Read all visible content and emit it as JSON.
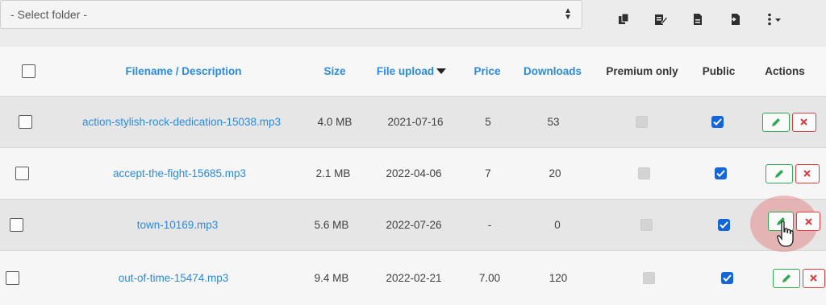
{
  "folder_select": {
    "value": "- Select folder -"
  },
  "toolbar": {
    "icons": [
      "copy-icon",
      "edit-document-icon",
      "file-icon",
      "file-move-icon",
      "more-options-icon"
    ]
  },
  "table": {
    "headers": {
      "filename": "Filename / Description",
      "size": "Size",
      "upload": "File upload",
      "price": "Price",
      "downloads": "Downloads",
      "premium": "Premium only",
      "public": "Public",
      "actions": "Actions"
    },
    "rows": [
      {
        "filename": "action-stylish-rock-dedication-15038.mp3",
        "size": "4.0 MB",
        "upload": "2021-07-16",
        "price": "5",
        "downloads": "53",
        "premium": false,
        "public": true
      },
      {
        "filename": "accept-the-fight-15685.mp3",
        "size": "2.1 MB",
        "upload": "2022-04-06",
        "price": "7",
        "downloads": "20",
        "premium": false,
        "public": true
      },
      {
        "filename": "town-10169.mp3",
        "size": "5.6 MB",
        "upload": "2022-07-26",
        "price": "-",
        "downloads": "0",
        "premium": false,
        "public": true
      },
      {
        "filename": "out-of-time-15474.mp3",
        "size": "9.4 MB",
        "upload": "2022-02-21",
        "price": "7.00",
        "downloads": "120",
        "premium": false,
        "public": true
      }
    ]
  },
  "colors": {
    "link": "#2a8be0",
    "edit": "#2eaa52",
    "delete": "#e0393e",
    "checked": "#1565d8"
  }
}
